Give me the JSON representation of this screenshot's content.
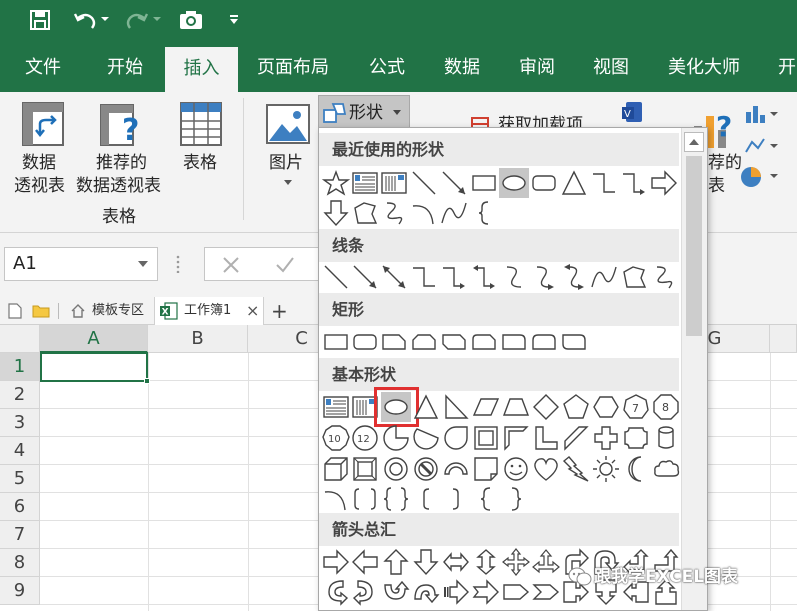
{
  "tabs": [
    {
      "label": "文件",
      "active": false
    },
    {
      "label": "开始",
      "active": false
    },
    {
      "label": "插入",
      "active": true
    },
    {
      "label": "页面布局",
      "active": false
    },
    {
      "label": "公式",
      "active": false
    },
    {
      "label": "数据",
      "active": false
    },
    {
      "label": "审阅",
      "active": false
    },
    {
      "label": "视图",
      "active": false
    },
    {
      "label": "美化大师",
      "active": false
    },
    {
      "label": "开",
      "active": false
    }
  ],
  "ribbon": {
    "pivot_label_1": "数据",
    "pivot_label_2": "透视表",
    "recommended_label_1": "推荐的",
    "recommended_label_2": "数据透视表",
    "table_label": "表格",
    "group_table_label": "表格",
    "picture_label": "图片",
    "shapes_label": "形状",
    "addins_label": "获取加载项",
    "right_partial_1": "荐的",
    "right_partial_2": "表"
  },
  "formula_bar": {
    "name_box": "A1"
  },
  "sheet_tabs": {
    "template_tab": "模板专区",
    "workbook_tab": "工作簿1",
    "add_label": "+",
    "close_label": "×"
  },
  "grid": {
    "columns": [
      "A",
      "B",
      "C",
      "G"
    ],
    "rows": [
      "1",
      "2",
      "3",
      "4",
      "5",
      "6",
      "7",
      "8",
      "9"
    ],
    "selected_cell": "A1"
  },
  "shapes_menu": {
    "sections": [
      {
        "label": "最近使用的形状"
      },
      {
        "label": "线条"
      },
      {
        "label": "矩形"
      },
      {
        "label": "基本形状"
      },
      {
        "label": "箭头总汇"
      }
    ],
    "highlighted_shape": "oval"
  },
  "watermark": "跟我学EXCEL图表",
  "colors": {
    "accent": "#217346",
    "highlight_box": "#e03030"
  }
}
